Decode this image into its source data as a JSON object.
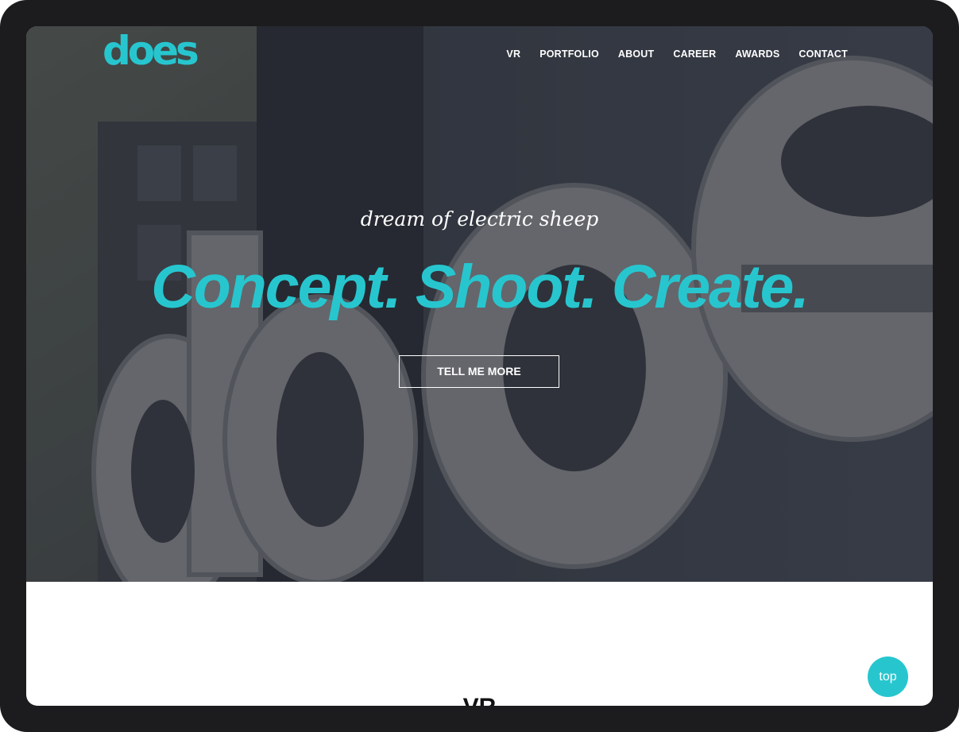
{
  "logo": {
    "text": "does"
  },
  "nav": {
    "items": [
      {
        "label": "VR"
      },
      {
        "label": "PORTFOLIO"
      },
      {
        "label": "ABOUT"
      },
      {
        "label": "CAREER"
      },
      {
        "label": "AWARDS"
      },
      {
        "label": "CONTACT"
      }
    ]
  },
  "hero": {
    "tagline": "dream of electric sheep",
    "headline": "Concept. Shoot. Create.",
    "cta_label": "TELL ME MORE",
    "background_icon": "does-sign-photo"
  },
  "section": {
    "title": "VR"
  },
  "scroll_top": {
    "label": "top"
  },
  "colors": {
    "accent": "#27c6cf",
    "frame": "#1c1c1e",
    "hero_bg": "#3b3f48",
    "text_light": "#ffffff",
    "text_dark": "#111111"
  }
}
